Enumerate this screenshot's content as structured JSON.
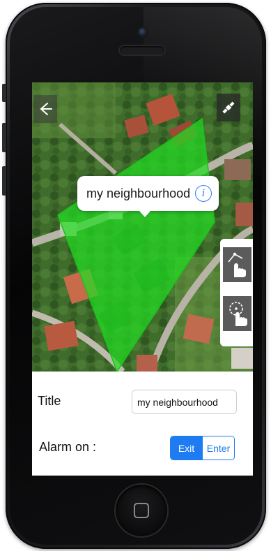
{
  "map": {
    "region_fill_color": "#22dd22",
    "back_icon": "back-arrow-icon",
    "map_type_icon": "satellite-icon"
  },
  "callout": {
    "title": "my neighbourhood",
    "info_icon": "info-icon",
    "info_glyph": "i"
  },
  "tools": [
    {
      "name": "draw-polygon-tool",
      "icon": "hand-polygon-icon"
    },
    {
      "name": "draw-circle-tool",
      "icon": "hand-circle-icon"
    }
  ],
  "form": {
    "title_label": "Title",
    "title_value": "my neighbourhood",
    "alarm_label": "Alarm on :",
    "alarm_options": [
      "Exit",
      "Enter"
    ],
    "alarm_selected": "Exit",
    "accent_color": "#1e7bf2"
  }
}
